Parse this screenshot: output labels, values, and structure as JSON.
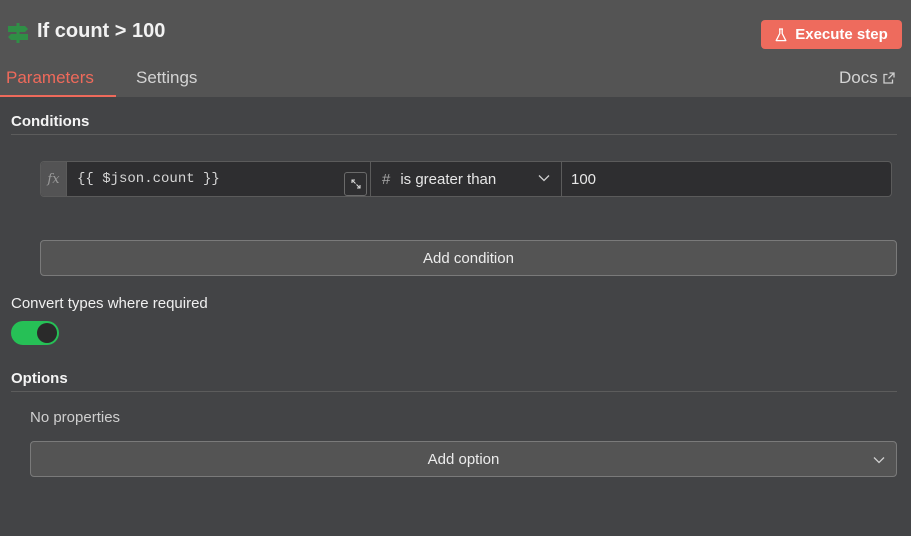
{
  "header": {
    "node_title": "If count > 100",
    "node_icon": "signpost-icon",
    "execute_label": "Execute step",
    "execute_icon": "flask-icon",
    "accent_color": "#ee6b5d"
  },
  "tabs": [
    {
      "label": "Parameters",
      "active": true
    },
    {
      "label": "Settings",
      "active": false
    }
  ],
  "docs": {
    "label": "Docs",
    "icon": "external-link-icon"
  },
  "conditions": {
    "section_label": "Conditions",
    "rows": [
      {
        "fx_label": "fx",
        "left_value": "{{ $json.count }}",
        "type_symbol": "#",
        "operator": "is greater than",
        "right_value": "100"
      }
    ],
    "add_button_label": "Add condition"
  },
  "convert_types": {
    "label": "Convert types where required",
    "enabled": true,
    "toggle_color": "#26c056"
  },
  "options": {
    "section_label": "Options",
    "empty_text": "No properties",
    "add_button_label": "Add option"
  }
}
